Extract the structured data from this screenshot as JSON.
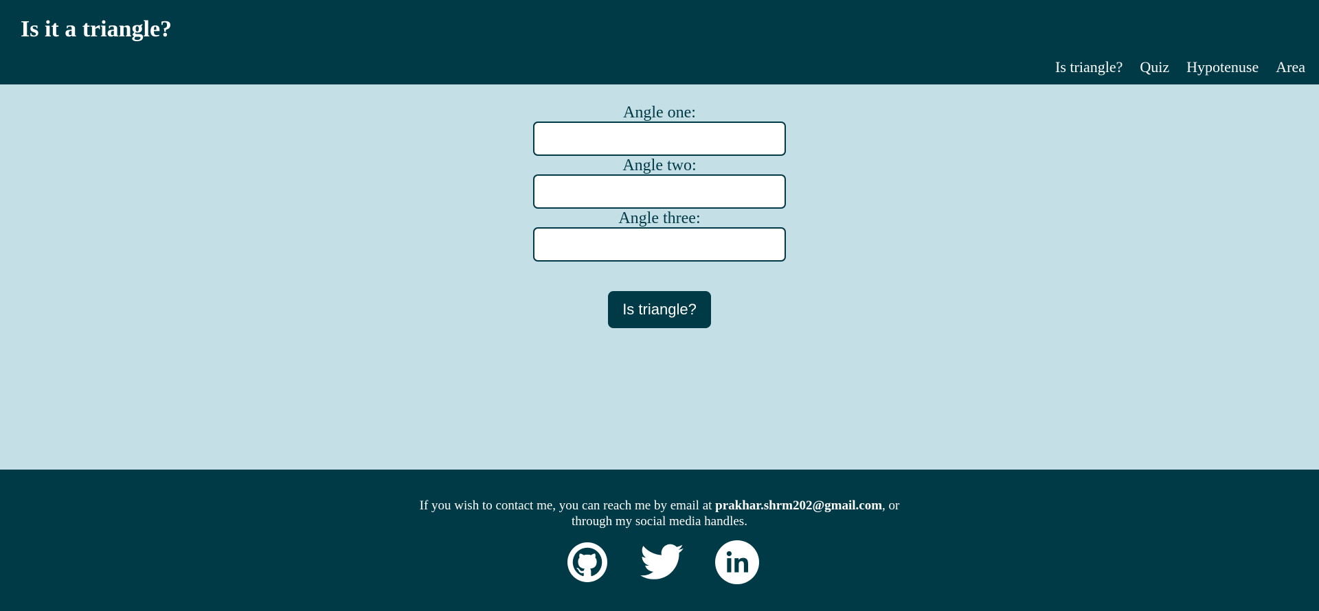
{
  "header": {
    "title": "Is it a triangle?",
    "nav": [
      "Is triangle?",
      "Quiz",
      "Hypotenuse",
      "Area"
    ]
  },
  "form": {
    "fields": [
      {
        "label": "Angle one:",
        "value": ""
      },
      {
        "label": "Angle two:",
        "value": ""
      },
      {
        "label": "Angle three:",
        "value": ""
      }
    ],
    "submit_label": "Is triangle?"
  },
  "footer": {
    "text_before": "If you wish to contact me, you can reach me by email at ",
    "email": "prakhar.shrm202@gmail.com",
    "text_after": ", or through my social media handles.",
    "social_icons": [
      "github-icon",
      "twitter-icon",
      "linkedin-icon"
    ]
  },
  "colors": {
    "primary": "#013a47",
    "background": "#c5dfe6",
    "text_light": "#ffffff"
  }
}
